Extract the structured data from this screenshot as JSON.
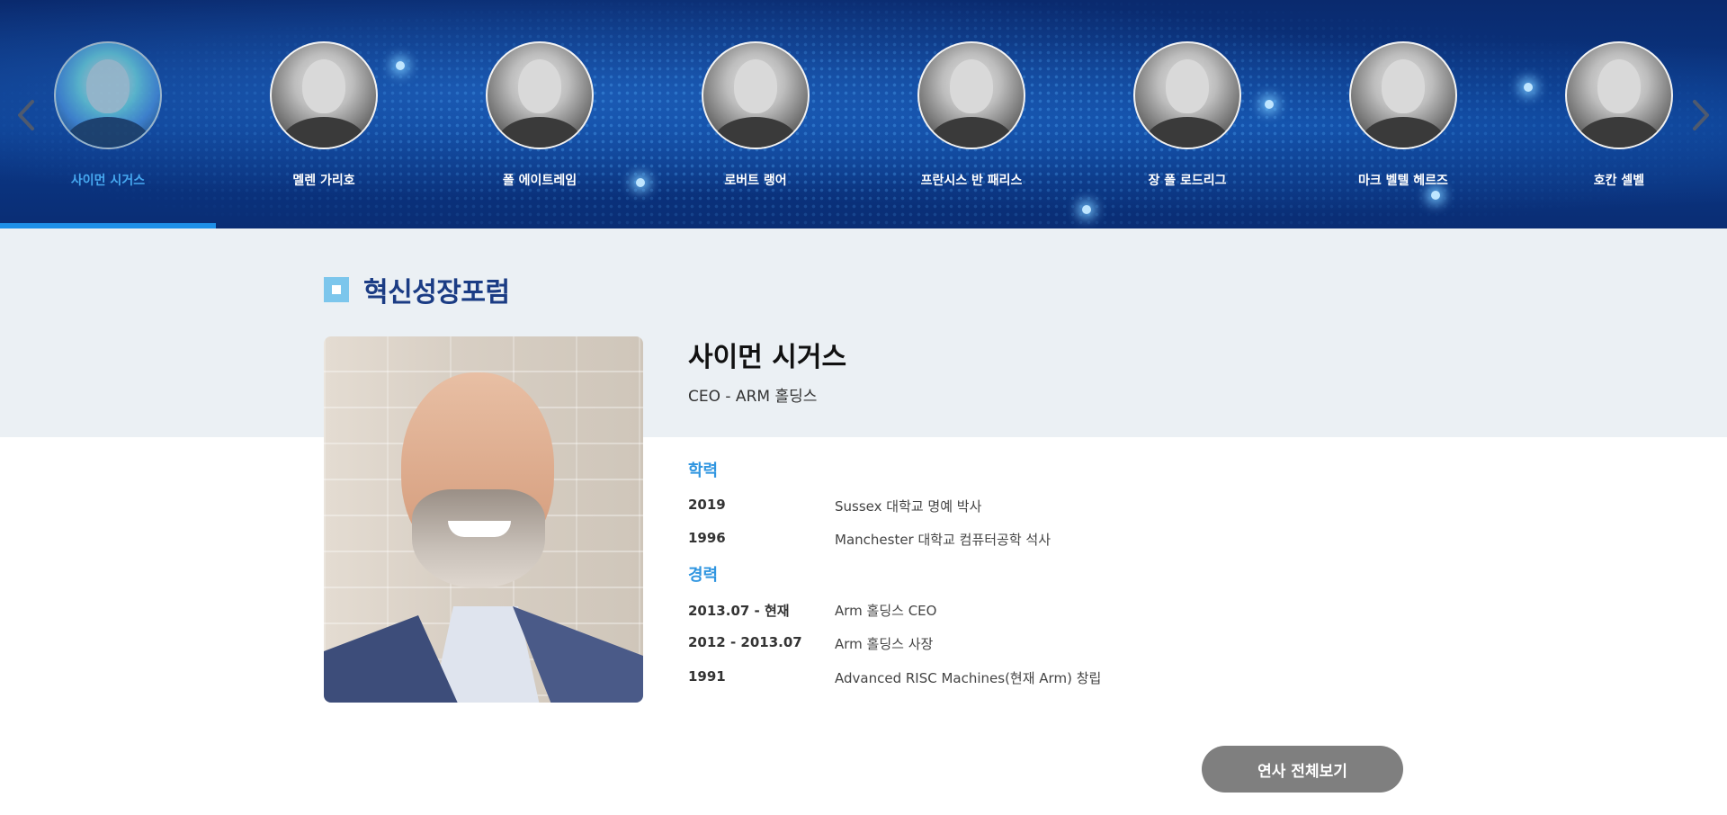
{
  "carousel": {
    "speakers": [
      {
        "name": "사이먼 시거스",
        "active": true
      },
      {
        "name": "멜렌 가리호",
        "active": false
      },
      {
        "name": "폴 에이트레임",
        "active": false
      },
      {
        "name": "로버트 랭어",
        "active": false
      },
      {
        "name": "프란시스 반 패리스",
        "active": false
      },
      {
        "name": "장 폴 로드리그",
        "active": false
      },
      {
        "name": "마크 벨텔 헤르즈",
        "active": false
      },
      {
        "name": "호칸 셀벨",
        "active": false
      }
    ],
    "prev_icon": "chevron-left-icon",
    "next_icon": "chevron-right-icon",
    "accent_color": "#1e90e8"
  },
  "section": {
    "title": "혁신성장포럼",
    "title_color": "#1b3c84"
  },
  "profile": {
    "name": "사이먼 시거스",
    "role": "CEO - ARM 홀딩스",
    "education_heading": "학력",
    "education": [
      {
        "year": "2019",
        "desc": "Sussex 대학교 명예 박사"
      },
      {
        "year": "1996",
        "desc": "Manchester 대학교 컴퓨터공학 석사"
      }
    ],
    "career_heading": "경력",
    "career": [
      {
        "year": "2013.07 - 현재",
        "desc": "Arm 홀딩스 CEO"
      },
      {
        "year": "2012 - 2013.07",
        "desc": "Arm 홀딩스 사장"
      },
      {
        "year": "1991",
        "desc": "Advanced RISC Machines(현재 Arm) 창립"
      }
    ]
  },
  "actions": {
    "view_all_label": "연사 전체보기"
  }
}
